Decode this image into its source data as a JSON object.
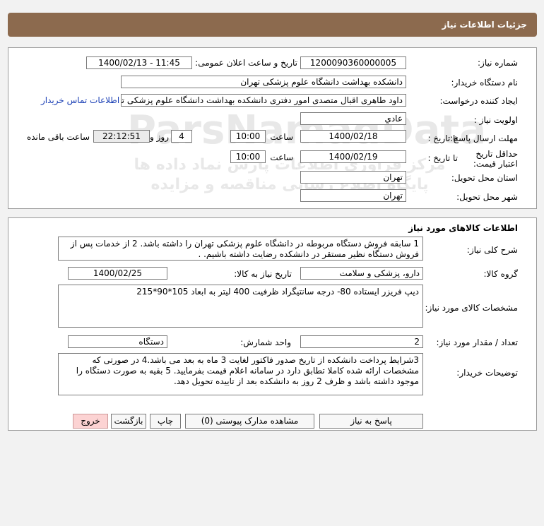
{
  "page_title": "جزئیات اطلاعات نیاز",
  "details": {
    "need_number_label": "شماره نیاز:",
    "need_number": "1200090360000005",
    "announce_label": "تاریخ و ساعت اعلان عمومی:",
    "announce_value": "1400/02/13 - 11:45",
    "buyer_org_label": "نام دستگاه خریدار:",
    "buyer_org": "دانشکده بهداشت دانشگاه علوم پزشکی تهران",
    "requester_label": "ایجاد کننده درخواست:",
    "requester": "داود طاهری اقبال متصدی امور دفتری دانشکده بهداشت دانشگاه علوم پزشکی تهران",
    "contact_link": "اطلاعات تماس خریدار",
    "priority_label": "اولویت نیاز :",
    "priority": "عادي",
    "send_deadline_label": "مهلت ارسال پاسخ:",
    "until_date_label": "تا تاریخ :",
    "send_date": "1400/02/18",
    "time_label": "ساعت",
    "send_time": "10:00",
    "days_value": "4",
    "days_label": "روز و",
    "remaining_time": "22:12:51",
    "remaining_label": "ساعت باقی مانده",
    "min_validity_label": "حداقل تاریخ اعتبار قیمت:",
    "validity_until_label": "تا تاریخ :",
    "validity_date": "1400/02/19",
    "validity_time_label": "ساعت",
    "validity_time": "10:00",
    "province_label": "استان محل تحویل:",
    "province": "تهران",
    "city_label": "شهر محل تحویل:",
    "city": "تهران"
  },
  "goods": {
    "section_title": "اطلاعات کالاهای مورد نیاز",
    "summary_label": "شرح کلی نیاز:",
    "summary": "1 سابقه فروش دستگاه مربوطه در دانشگاه علوم پزشکی تهران را داشته باشد. 2 از خدمات پس از فروش دستگاه نظیر مستقر در دانشکده رضایت داشته باشیم. .",
    "group_label": "گروه کالا:",
    "group": "دارو، پزشکی و سلامت",
    "need_date_label": "تاریخ نیاز به کالا:",
    "need_date": "1400/02/25",
    "specs_label": "مشخصات کالای مورد نیاز:",
    "specs": "دیپ فریزر ایستاده 80- درجه سانتیگراد  ظرفیت 400 لیتر به ابعاد 105*90*215",
    "qty_label": "تعداد / مقدار مورد نیاز:",
    "qty": "2",
    "unit_label": "واحد شمارش:",
    "unit": "دستگاه",
    "buyer_notes_label": "توضیحات خریدار:",
    "buyer_notes": "3شرایط پرداخت دانشکده از تاریخ صدور فاکتور لغایت 3 ماه به بعد می باشد.4 در صورتی که مشخصات ارائه شده کاملا تطابق دارد در سامانه اعلام قیمت بفرمایید. 5  بقیه به صورت دستگاه را موجود داشته باشد و ظرف 2 روز به دانشکده بعد از تاییده تحویل دهد."
  },
  "buttons": {
    "reply": "پاسخ به نیاز",
    "attachments": "مشاهده مدارک پیوستی (0)",
    "print": "چاپ",
    "back": "بازگشت",
    "exit": "خروج"
  },
  "watermark": {
    "line1": "ParsNamadData",
    "line2": "مرکز فرآوری اطلاعات پارس نماد داده ها",
    "line3": "پایگاه اطلاع رسانی مناقصه و مزایده"
  }
}
